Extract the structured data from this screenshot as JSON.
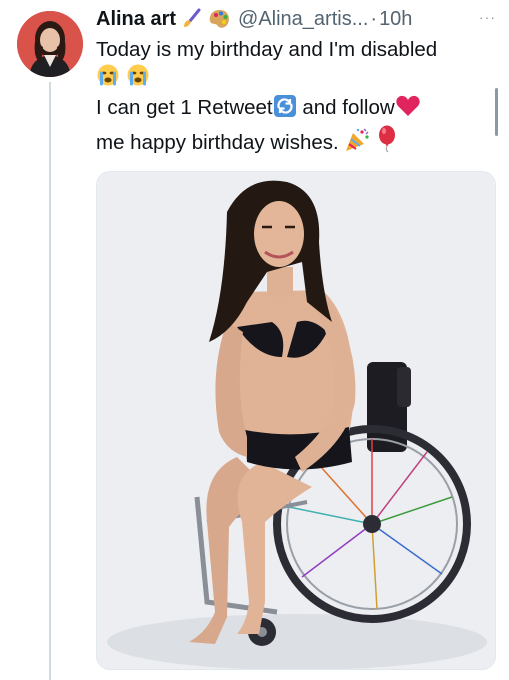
{
  "tweet": {
    "author_name": "Alina art",
    "handle": "@Alina_artis...",
    "separator": "·",
    "time": "10h",
    "more_label": "···",
    "name_emojis": [
      "paintbrush-emoji",
      "palette-emoji"
    ],
    "text_lines": [
      "Today is my birthday and I'm disabled",
      "I can get 1 Retweet",
      "and follow",
      "me happy birthday wishes."
    ],
    "emojis": [
      "crying-face-emoji",
      "crying-face-emoji",
      "retweet-emoji",
      "red-heart-emoji",
      "party-popper-emoji",
      "balloon-emoji"
    ]
  },
  "media": {
    "alt": "Woman in a black bikini sitting in a wheelchair"
  },
  "colors": {
    "text_primary": "#0f1419",
    "text_secondary": "#536471",
    "avatar_bg": "#d9534a",
    "heart": "#e0245e",
    "retweet_icon": "#4a90d9"
  }
}
